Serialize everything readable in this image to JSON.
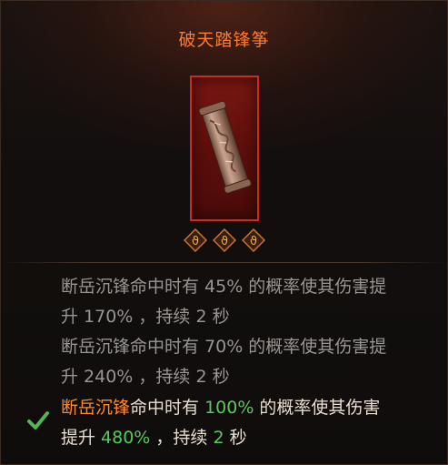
{
  "item": {
    "name": "破天踏锋筝",
    "gem_count": 3,
    "frame_color": "#c92c21",
    "title_color": "#ff7a2b",
    "icon": "scroll-icon"
  },
  "tiers": [
    {
      "active": false,
      "line1": "断岳沉锋命中时有 45% 的概率使其伤害提",
      "line2": "升 170% ，持续 2 秒"
    },
    {
      "active": false,
      "line1": "断岳沉锋命中时有 70% 的概率使其伤害提",
      "line2": "升 240% ，持续 2 秒"
    },
    {
      "active": true,
      "l1_skill": "断岳沉锋",
      "l1_a": "命中时有 ",
      "l1_pct": "100%",
      "l1_b": " 的概率使其伤害",
      "l2_a": "提升 ",
      "l2_pct": "480%",
      "l2_b": " ，持续 ",
      "l2_dur": "2",
      "l2_c": " 秒"
    }
  ],
  "colors": {
    "skill": "#ff8a2e",
    "highlight": "#58c957",
    "inactive_text": "#9a9590"
  }
}
